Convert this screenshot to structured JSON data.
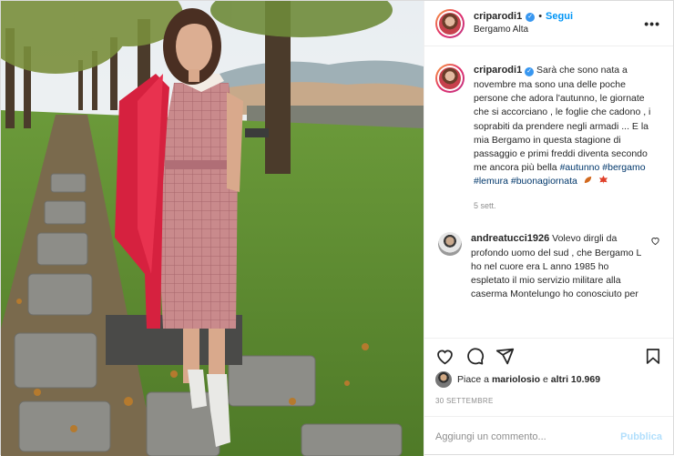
{
  "header": {
    "username": "criparodi1",
    "separator": "•",
    "follow_label": "Segui",
    "location": "Bergamo Alta",
    "more_label": "•••"
  },
  "caption": {
    "username": "criparodi1",
    "text": "Sarà che sono nata a novembre ma sono una delle poche persone che adora l'autunno, le giornate che si accorciano , le foglie che cadono , i soprabiti da prendere negli armadi ... E la mia Bergamo in questa stagione di passaggio e primi freddi diventa secondo me ancora più bella",
    "hashtags": [
      "#autunno",
      "#bergamo",
      "#lemura",
      "#buonagiornata"
    ],
    "time": "5 sett."
  },
  "comment": {
    "username": "andreatucci1926",
    "text": "Volevo dirgli da profondo uomo del sud , che Bergamo L ho nel cuore era L anno 1985 ho espletato il mio servizio militare alla caserma Montelungo ho conosciuto per"
  },
  "icons": {
    "like": "heart-icon",
    "comment": "comment-icon",
    "share": "share-icon",
    "save": "bookmark-icon"
  },
  "likes": {
    "prefix": "Piace a ",
    "user": "mariolosio",
    "middle": " e ",
    "others": "altri 10.969"
  },
  "date": "30 SETTEMBRE",
  "add_comment": {
    "placeholder": "Aggiungi un commento...",
    "publish_label": "Pubblica"
  },
  "colors": {
    "link_blue": "#0095f6",
    "hashtag": "#00376b",
    "muted": "#8e8e8e",
    "publish_disabled": "#b2dffc",
    "verified": "#3897f0"
  }
}
